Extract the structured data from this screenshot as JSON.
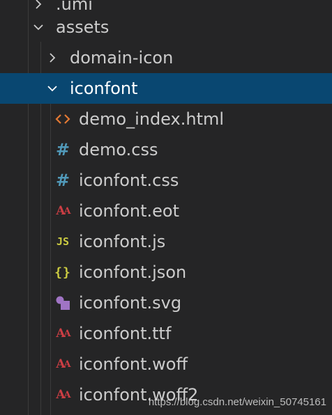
{
  "explorer": {
    "items": [
      {
        "label": ".umi",
        "kind": "folder",
        "expanded": false,
        "icon": "chevron-right-icon"
      },
      {
        "label": "assets",
        "kind": "folder",
        "expanded": true,
        "icon": "chevron-down-icon"
      },
      {
        "label": "domain-icon",
        "kind": "folder",
        "expanded": false,
        "icon": "chevron-right-icon"
      },
      {
        "label": "iconfont",
        "kind": "folder",
        "expanded": true,
        "selected": true,
        "icon": "chevron-down-icon"
      },
      {
        "label": "demo_index.html",
        "kind": "file",
        "icon": "html-file-icon",
        "icon_glyph": "<>",
        "icon_color": "#e37933"
      },
      {
        "label": "demo.css",
        "kind": "file",
        "icon": "css-file-icon",
        "icon_glyph": "#",
        "icon_color": "#519aba"
      },
      {
        "label": "iconfont.css",
        "kind": "file",
        "icon": "css-file-icon",
        "icon_glyph": "#",
        "icon_color": "#519aba"
      },
      {
        "label": "iconfont.eot",
        "kind": "file",
        "icon": "font-file-icon",
        "icon_glyph": "Aa",
        "icon_color": "#cc3e44"
      },
      {
        "label": "iconfont.js",
        "kind": "file",
        "icon": "js-file-icon",
        "icon_glyph": "JS",
        "icon_color": "#cbcb41"
      },
      {
        "label": "iconfont.json",
        "kind": "file",
        "icon": "json-file-icon",
        "icon_glyph": "{ }",
        "icon_color": "#cbcb41"
      },
      {
        "label": "iconfont.svg",
        "kind": "file",
        "icon": "svg-file-icon",
        "icon_glyph": "",
        "icon_color": "#a074c4"
      },
      {
        "label": "iconfont.ttf",
        "kind": "file",
        "icon": "font-file-icon",
        "icon_glyph": "Aa",
        "icon_color": "#cc3e44"
      },
      {
        "label": "iconfont.woff",
        "kind": "file",
        "icon": "font-file-icon",
        "icon_glyph": "Aa",
        "icon_color": "#cc3e44"
      },
      {
        "label": "iconfont.woff2",
        "kind": "file",
        "icon": "font-file-icon",
        "icon_glyph": "Aa",
        "icon_color": "#cc3e44"
      }
    ]
  },
  "watermark": "https://blog.csdn.net/weixin_50745161",
  "colors": {
    "background": "#252526",
    "selection": "#094771",
    "text": "#cccccc"
  }
}
